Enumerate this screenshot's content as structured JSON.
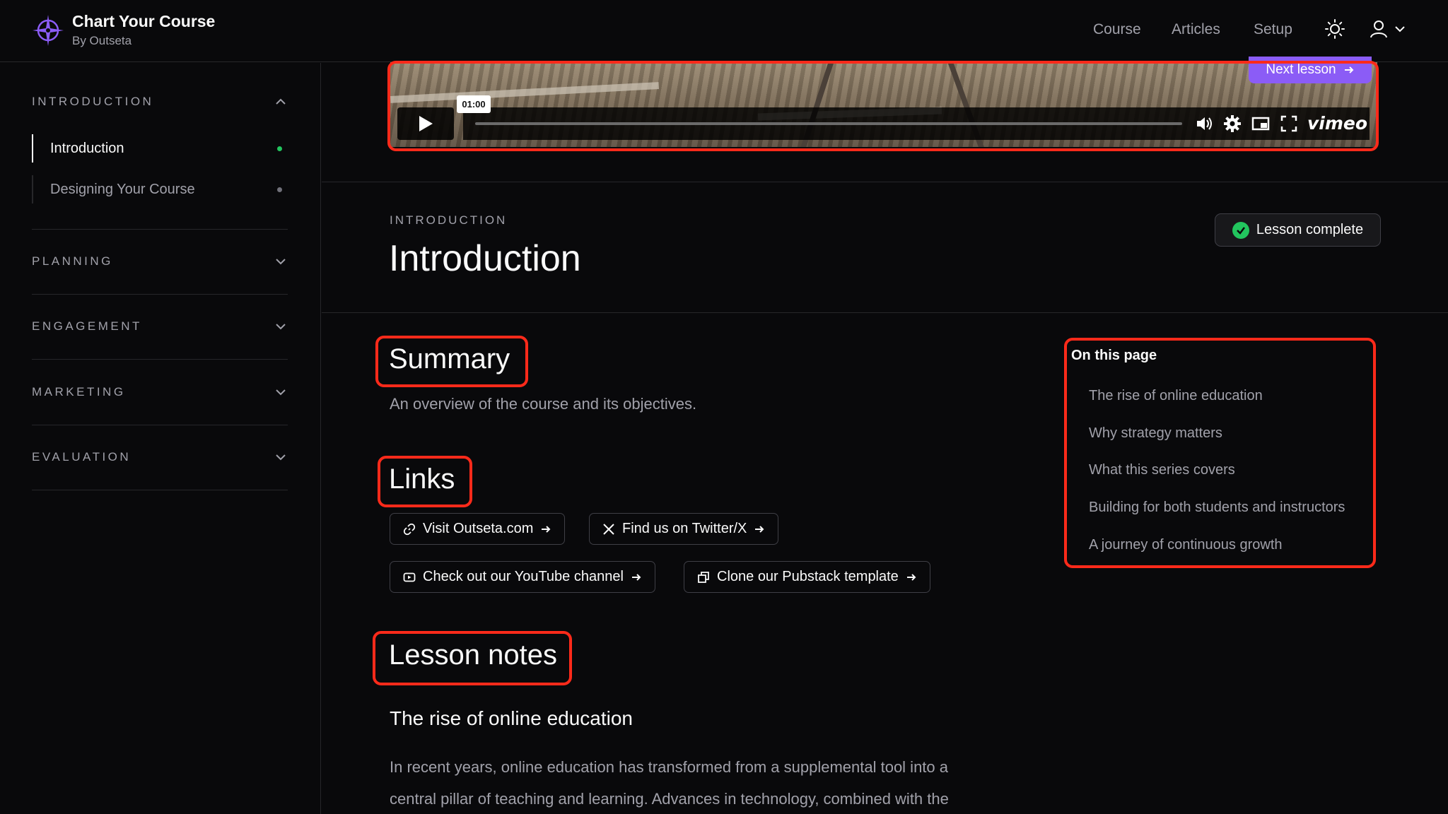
{
  "brand": {
    "title": "Chart Your Course",
    "subtitle": "By Outseta",
    "accent": "#8b5cf6"
  },
  "nav": {
    "links": [
      "Course",
      "Articles",
      "Setup"
    ]
  },
  "sidebar": {
    "sections": [
      {
        "label": "INTRODUCTION",
        "expanded": true,
        "lessons": [
          {
            "label": "Introduction",
            "active": true,
            "status": "complete"
          },
          {
            "label": "Designing Your Course",
            "active": false,
            "status": "incomplete"
          }
        ]
      },
      {
        "label": "PLANNING",
        "expanded": false
      },
      {
        "label": "ENGAGEMENT",
        "expanded": false
      },
      {
        "label": "MARKETING",
        "expanded": false
      },
      {
        "label": "EVALUATION",
        "expanded": false
      }
    ]
  },
  "video": {
    "next_lesson": "Next lesson",
    "time": "01:00",
    "provider": "vimeo"
  },
  "lesson": {
    "eyebrow": "INTRODUCTION",
    "title": "Introduction",
    "complete_label": "Lesson complete",
    "summary_heading": "Summary",
    "summary_text": "An overview of the course and its objectives.",
    "links_heading": "Links",
    "links": [
      {
        "label": "Visit Outseta.com",
        "icon": "link-icon"
      },
      {
        "label": "Find us on Twitter/X",
        "icon": "x-logo-icon"
      },
      {
        "label": "Check out our YouTube channel",
        "icon": "youtube-icon"
      },
      {
        "label": "Clone our Pubstack template",
        "icon": "copy-icon"
      }
    ],
    "notes_heading": "Lesson notes",
    "notes_subheading": "The rise of online education",
    "notes_paragraph_line1": "In recent years, online education has transformed from a supplemental tool into a",
    "notes_paragraph_line2": "central pillar of teaching and learning. Advances in technology, combined with the"
  },
  "toc": {
    "title": "On this page",
    "items": [
      "The rise of online education",
      "Why strategy matters",
      "What this series covers",
      "Building for both students and instructors",
      "A journey of continuous growth"
    ]
  },
  "colors": {
    "highlight": "#ff2a1a",
    "success": "#22c55e",
    "background": "#09090b"
  }
}
